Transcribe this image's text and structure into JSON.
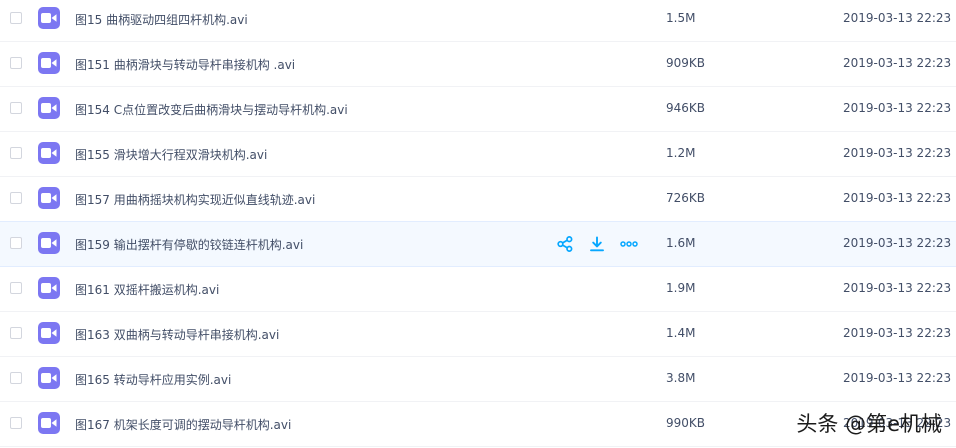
{
  "files": [
    {
      "name": "图15 曲柄驱动四组四杆机构.avi",
      "size": "1.5M",
      "date": "2019-03-13 22:23"
    },
    {
      "name": "图151 曲柄滑块与转动导杆串接机构 .avi",
      "size": "909KB",
      "date": "2019-03-13 22:23"
    },
    {
      "name": "图154 C点位置改变后曲柄滑块与摆动导杆机构.avi",
      "size": "946KB",
      "date": "2019-03-13 22:23"
    },
    {
      "name": "图155 滑块增大行程双滑块机构.avi",
      "size": "1.2M",
      "date": "2019-03-13 22:23"
    },
    {
      "name": "图157 用曲柄摇块机构实现近似直线轨迹.avi",
      "size": "726KB",
      "date": "2019-03-13 22:23"
    },
    {
      "name": "图159 输出摆杆有停歇的铰链连杆机构.avi",
      "size": "1.6M",
      "date": "2019-03-13 22:23"
    },
    {
      "name": "图161 双摇杆搬运机构.avi",
      "size": "1.9M",
      "date": "2019-03-13 22:23"
    },
    {
      "name": "图163 双曲柄与转动导杆串接机构.avi",
      "size": "1.4M",
      "date": "2019-03-13 22:23"
    },
    {
      "name": "图165 转动导杆应用实例.avi",
      "size": "3.8M",
      "date": "2019-03-13 22:23"
    },
    {
      "name": "图167 机架长度可调的摆动导杆机构.avi",
      "size": "990KB",
      "date": "2019-03-13 22:23"
    }
  ],
  "hovered_row_index": 5,
  "hover_actions": {
    "share_icon": "share-icon",
    "download_icon": "download-icon",
    "more_icon": "more-icon"
  },
  "colors": {
    "icon_purple": "#7c77f2",
    "action_blue": "#06a7ff",
    "text": "#424e67",
    "hover_bg": "#f4f9ff"
  },
  "watermark": {
    "text": "头条 @第e机械"
  }
}
